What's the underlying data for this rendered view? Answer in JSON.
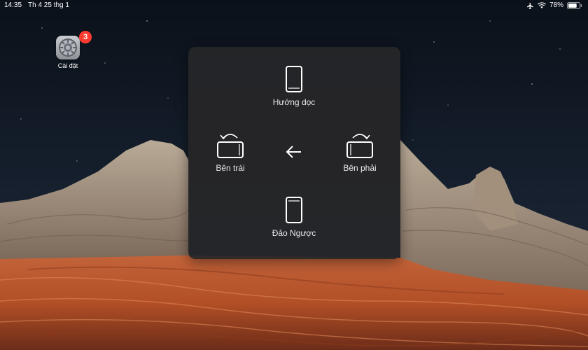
{
  "status_bar": {
    "time": "14:35",
    "date": "Th 4 25 thg 1",
    "battery_percent": "78%",
    "battery_level": 0.78,
    "icons": [
      "airplane-icon",
      "wifi-icon",
      "battery-icon"
    ]
  },
  "home_screen": {
    "app": {
      "label": "Cài đặt",
      "badge": "3",
      "icon": "gear-icon"
    }
  },
  "rotate_menu": {
    "portrait": "Hướng dọc",
    "left": "Bên trái",
    "right": "Bên phải",
    "upside_down": "Đảo Ngược",
    "back_icon": "back-arrow-icon"
  },
  "colors": {
    "badge": "#ff3b30",
    "panel": "#262628",
    "text": "#e9e9ec"
  }
}
